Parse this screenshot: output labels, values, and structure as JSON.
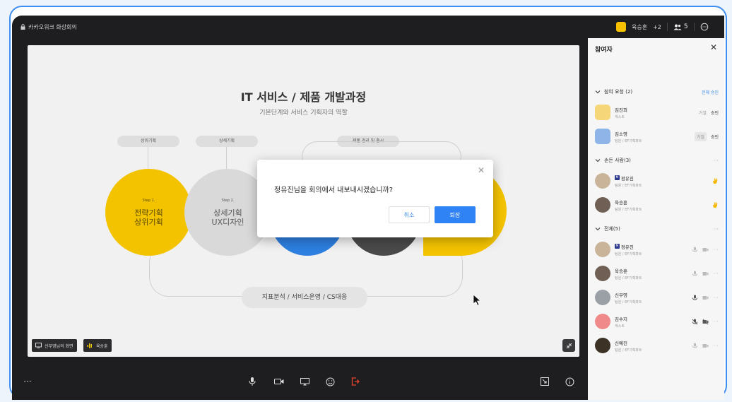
{
  "topbar": {
    "title": "카카오워크 화상회의",
    "host_name": "육승훈",
    "host_extra": "+2",
    "participant_count": "5"
  },
  "slide": {
    "title": "IT 서비스 / 제품 개발과정",
    "subtitle": "기본단계와 서비스 기획자의 역할",
    "labels": [
      "상위기획",
      "상세기획",
      "제품 관리 및 출시"
    ],
    "circle1_step": "Step 1.",
    "circle1_text": "전략기획\n상위기획",
    "circle2_step": "Step 2.",
    "circle2_text": "상세기획\nUX디자인",
    "bottom_label": "지표분석 / 서비스운영 / CS대응"
  },
  "stage_chips": {
    "screen_share": "신부영님의 화면",
    "speaker": "육승훈"
  },
  "modal": {
    "message": "정유진님을 회의에서 내보내시겠습니까?",
    "cancel_label": "취소",
    "confirm_label": "퇴장"
  },
  "sidebar": {
    "title": "참여자",
    "sections": {
      "requests": {
        "label": "참여 요청 (2)",
        "action": "전체 승인"
      },
      "raised": {
        "label": "손든 사람(3)"
      },
      "all": {
        "label": "전체(5)"
      }
    },
    "requests": [
      {
        "name": "김진희",
        "role": "게스트",
        "deny": "거절",
        "accept": "승인",
        "color": "#f5d77a"
      },
      {
        "name": "김소영",
        "role": "팀원 / EF기획파트",
        "deny": "거절",
        "accept": "승인",
        "color": "#8fb4e8"
      }
    ],
    "raised": [
      {
        "name": "정유진",
        "role": "팀원 / EF기획파트",
        "badge": "M"
      },
      {
        "name": "육승훈",
        "role": "팀원 / EF기획파트"
      }
    ],
    "all": [
      {
        "name": "정유진",
        "role": "팀원 / EF기획파트",
        "badge": "M"
      },
      {
        "name": "육승훈",
        "role": "팀원 / EF기획파트"
      },
      {
        "name": "신부영",
        "role": "팀원 / EF기획파트"
      },
      {
        "name": "김수지",
        "role": "게스트"
      },
      {
        "name": "신예진",
        "role": "팀원 / EF기획파트"
      }
    ]
  },
  "colors": {
    "accent": "#2f83f5",
    "yellow": "#f3c300",
    "gray_circle": "#d9d9d9",
    "blue_circle": "#2d7fe0",
    "dark_circle": "#4a4a4a",
    "raise_hand": "#f5b800",
    "leave": "#e5432d"
  }
}
